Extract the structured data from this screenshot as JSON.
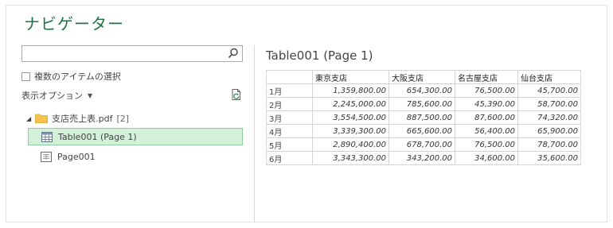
{
  "app": {
    "title": "ナビゲーター"
  },
  "search": {
    "placeholder": "",
    "value": ""
  },
  "multi_select": {
    "label": "複数のアイテムの選択",
    "checked": false
  },
  "display_options": {
    "label": "表示オプション"
  },
  "tree": {
    "folder": {
      "name": "支店売上表.pdf",
      "count": "[2]"
    },
    "items": [
      {
        "label": "Table001 (Page 1)",
        "selected": true,
        "icon": "table-icon"
      },
      {
        "label": "Page001",
        "selected": false,
        "icon": "page-icon"
      }
    ]
  },
  "preview": {
    "title": "Table001 (Page 1)",
    "columns": [
      "",
      "東京支店",
      "大阪支店",
      "名古屋支店",
      "仙台支店"
    ],
    "rows": [
      {
        "label": "1月",
        "values": [
          "1,359,800.00",
          "654,300.00",
          "76,500.00",
          "45,700.00"
        ]
      },
      {
        "label": "2月",
        "values": [
          "2,245,000.00",
          "785,600.00",
          "45,390.00",
          "58,700.00"
        ]
      },
      {
        "label": "3月",
        "values": [
          "3,554,500.00",
          "887,500.00",
          "87,600.00",
          "74,320.00"
        ]
      },
      {
        "label": "4月",
        "values": [
          "3,339,300.00",
          "665,600.00",
          "56,400.00",
          "65,900.00"
        ]
      },
      {
        "label": "5月",
        "values": [
          "2,890,400.00",
          "678,700.00",
          "76,500.00",
          "78,700.00"
        ]
      },
      {
        "label": "6月",
        "values": [
          "3,343,300.00",
          "343,200.00",
          "34,600.00",
          "35,600.00"
        ]
      }
    ]
  },
  "colors": {
    "accent": "#217346",
    "selection_bg": "#d3f0d8",
    "selection_border": "#8ed09a"
  }
}
